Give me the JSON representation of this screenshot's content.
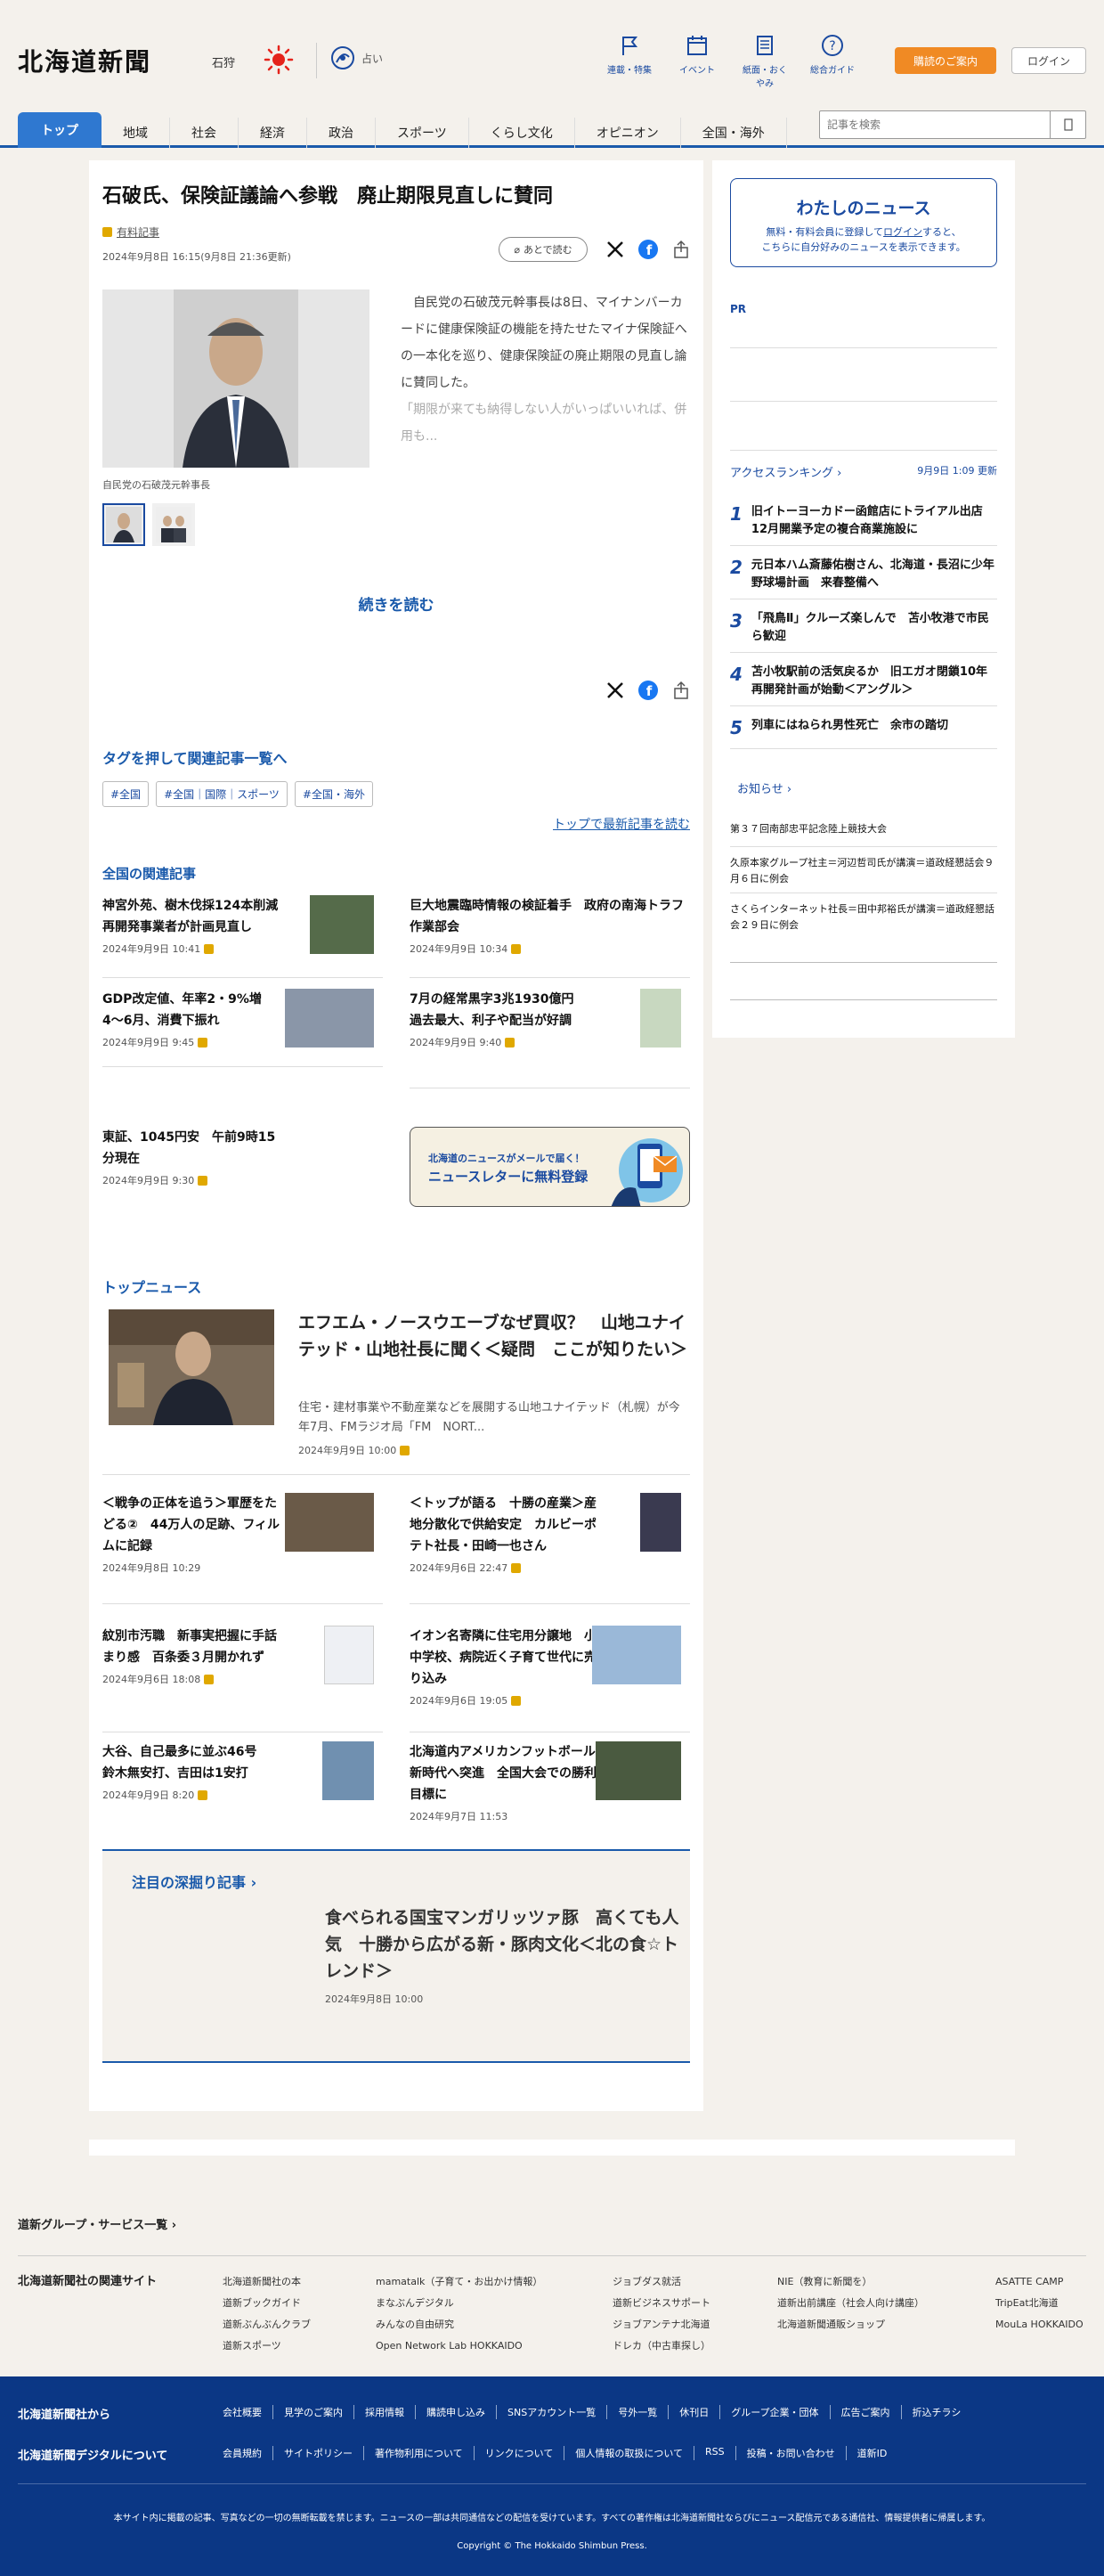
{
  "header": {
    "logo": "北海道新聞",
    "region": "石狩",
    "uranai": "占い",
    "icons": [
      {
        "name": "flag-icon",
        "label": "連載・特集"
      },
      {
        "name": "calendar-icon",
        "label": "イベント"
      },
      {
        "name": "paper-icon",
        "label": "紙面・おくやみ"
      },
      {
        "name": "help-icon",
        "label": "総合ガイド"
      }
    ],
    "subscribe": "購読のご案内",
    "login": "ログイン"
  },
  "nav": {
    "tabs": [
      "トップ",
      "地域",
      "社会",
      "経済",
      "政治",
      "スポーツ",
      "くらし文化",
      "オピニオン",
      "全国・海外"
    ],
    "search_placeholder": "記事を検索"
  },
  "article": {
    "title": "石破氏、保険証議論へ参戦　廃止期限見直しに賛同",
    "paid": "有料記事",
    "date": "2024年9月8日 16:15(9月8日 21:36更新)",
    "later": "あとで読む",
    "caption": "自民党の石破茂元幹事長",
    "lede": "自民党の石破茂元幹事長は8日、マイナンバーカードに健康保険証の機能を持たせたマイナ保険証への一本化を巡り、健康保険証の廃止期限の見直し論に賛同した。",
    "lede_fade": "「期限が来ても納得しない人がいっぱいいれば、併用も...",
    "readmore": "続きを読む"
  },
  "tags": {
    "heading": "タグを押して関連記事一覧へ",
    "items": [
      "#全国",
      "#全国｜国際｜スポーツ",
      "#全国・海外"
    ],
    "toplink": "トップで最新記事を読む"
  },
  "related": {
    "heading": "全国の関連記事",
    "items": [
      {
        "title": "神宮外苑、樹木伐採124本削減　再開発事業者が計画見直し",
        "date": "2024年9月9日 10:41"
      },
      {
        "title": "巨大地震臨時情報の検証着手　政府の南海トラフ作業部会",
        "date": "2024年9月9日 10:34"
      },
      {
        "title": "GDP改定値、年率2・9%増　4～6月、消費下振れ",
        "date": "2024年9月9日 9:45"
      },
      {
        "title": "7月の経常黒字3兆1930億円　過去最大、利子や配当が好調",
        "date": "2024年9月9日 9:40"
      },
      {
        "title": "東証、1045円安　午前9時15分現在",
        "date": "2024年9月9日 9:30"
      }
    ],
    "newsletter_line1": "北海道のニュースがメールで届く！",
    "newsletter_line2": "ニュースレターに無料登録"
  },
  "top_news": {
    "heading": "トップニュース",
    "lead": {
      "title": "エフエム・ノースウエーブなぜ買収？　山地ユナイテッド・山地社長に聞く＜疑問　ここが知りたい＞",
      "desc": "住宅・建材事業や不動産業などを展開する山地ユナイテッド（札幌）が今年7月、FMラジオ局「FM　NORT...",
      "date": "2024年9月9日 10:00"
    },
    "items": [
      {
        "title": "＜戦争の正体を追う＞軍歴をたどる②　44万人の足跡、フィルムに記録",
        "date": "2024年9月8日 10:29"
      },
      {
        "title": "＜トップが語る　十勝の産業＞産地分散化で供給安定　カルビーポテト社長・田崎一也さん",
        "date": "2024年9月6日 22:47"
      },
      {
        "title": "紋別市汚職　新事実把握に手話まり感　百条委３月開かれず",
        "date": "2024年9月6日 18:08"
      },
      {
        "title": "イオン名寄隣に住宅用分譲地　小中学校、病院近く子育て世代に売り込み",
        "date": "2024年9月6日 19:05"
      },
      {
        "title": "大谷、自己最多に並ぶ46号　鈴木無安打、吉田は1安打",
        "date": "2024年9月9日 8:20"
      },
      {
        "title": "北海道内アメリカンフットボール　新時代へ突進　全国大会での勝利目標に",
        "date": "2024年9月7日 11:53"
      }
    ]
  },
  "deep": {
    "heading": "注目の深掘り記事",
    "title": "食べられる国宝マンガリッツァ豚　高くても人気　十勝から広がる新・豚肉文化＜北の食☆トレンド＞",
    "date": "2024年9月8日 10:00"
  },
  "sidebar": {
    "my_news_title": "わたしのニュース",
    "my_news_line1": "無料・有料会員に登録して",
    "my_news_login": "ログイン",
    "my_news_line1b": "すると、",
    "my_news_line2": "こちらに自分好みのニュースを表示できます。",
    "pr": "PR",
    "ranking_title": "アクセスランキング",
    "ranking_updated": "9月9日 1:09 更新",
    "ranking": [
      {
        "n": "1",
        "title": "旧イトーヨーカドー函館店にトライアル出店　12月開業予定の複合商業施設に"
      },
      {
        "n": "2",
        "title": "元日本ハム斎藤佑樹さん、北海道・長沼に少年野球場計画　来春整備へ"
      },
      {
        "n": "3",
        "title": "「飛鳥Ⅱ」クルーズ楽しんで　苫小牧港で市民ら歓迎"
      },
      {
        "n": "4",
        "title": "苫小牧駅前の活気戻るか　旧エガオ閉鎖10年　再開発計画が始動＜アングル＞"
      },
      {
        "n": "5",
        "title": "列車にはねられ男性死亡　余市の踏切"
      }
    ],
    "notice_title": "お知らせ",
    "notices": [
      "第３７回南部忠平記念陸上競技大会",
      "久原本家グループ社主＝河辺哲司氏が講演＝道政経懇話会９月６日に例会",
      "さくらインターネット社長＝田中邦裕氏が講演＝道政経懇話会２９日に例会"
    ]
  },
  "footer": {
    "group_services": "道新グループ・サービス一覧",
    "related_sites": "北海道新聞社の関連サイト",
    "cols": [
      [
        "北海道新聞社の本",
        "道新ブックガイド",
        "道新ぶんぶんクラブ",
        "道新スポーツ"
      ],
      [
        "mamatalk（子育て・お出かけ情報）",
        "まなぶんデジタル",
        "みんなの自由研究",
        "Open Network Lab HOKKAIDO"
      ],
      [
        "ジョブダス就活",
        "道新ビジネスサポート",
        "ジョブアンテナ北海道",
        "ドレカ（中古車探し）"
      ],
      [
        "NIE（教育に新聞を）",
        "道新出前講座（社会人向け講座）",
        "北海道新聞通販ショップ"
      ],
      [
        "ASATTE CAMP",
        "TripEat北海道",
        "MouLa HOKKAIDO"
      ]
    ],
    "from_company": "北海道新聞社から",
    "company_links": [
      "会社概要",
      "見学のご案内",
      "採用情報",
      "購読申し込み",
      "SNSアカウント一覧",
      "号外一覧",
      "休刊日",
      "グループ企業・団体",
      "広告ご案内",
      "折込チラシ"
    ],
    "about_digital": "北海道新聞デジタルについて",
    "digital_links": [
      "会員規約",
      "サイトポリシー",
      "著作物利用について",
      "リンクについて",
      "個人情報の取扱について",
      "RSS",
      "投稿・お問い合わせ",
      "道新ID"
    ],
    "legal": "本サイト内に掲載の記事、写真などの一切の無断転載を禁じます。ニュースの一部は共同通信などの配信を受けています。すべての著作権は北海道新聞社ならびにニュース配信元である通信社、情報提供者に帰属します。",
    "copyright": "Copyright © The Hokkaido Shimbun Press."
  },
  "colors": {
    "accent": "#1a5aab",
    "subscribe": "#f08a24",
    "footer": "#0b3785",
    "page_bg": "#f4f1ec"
  }
}
